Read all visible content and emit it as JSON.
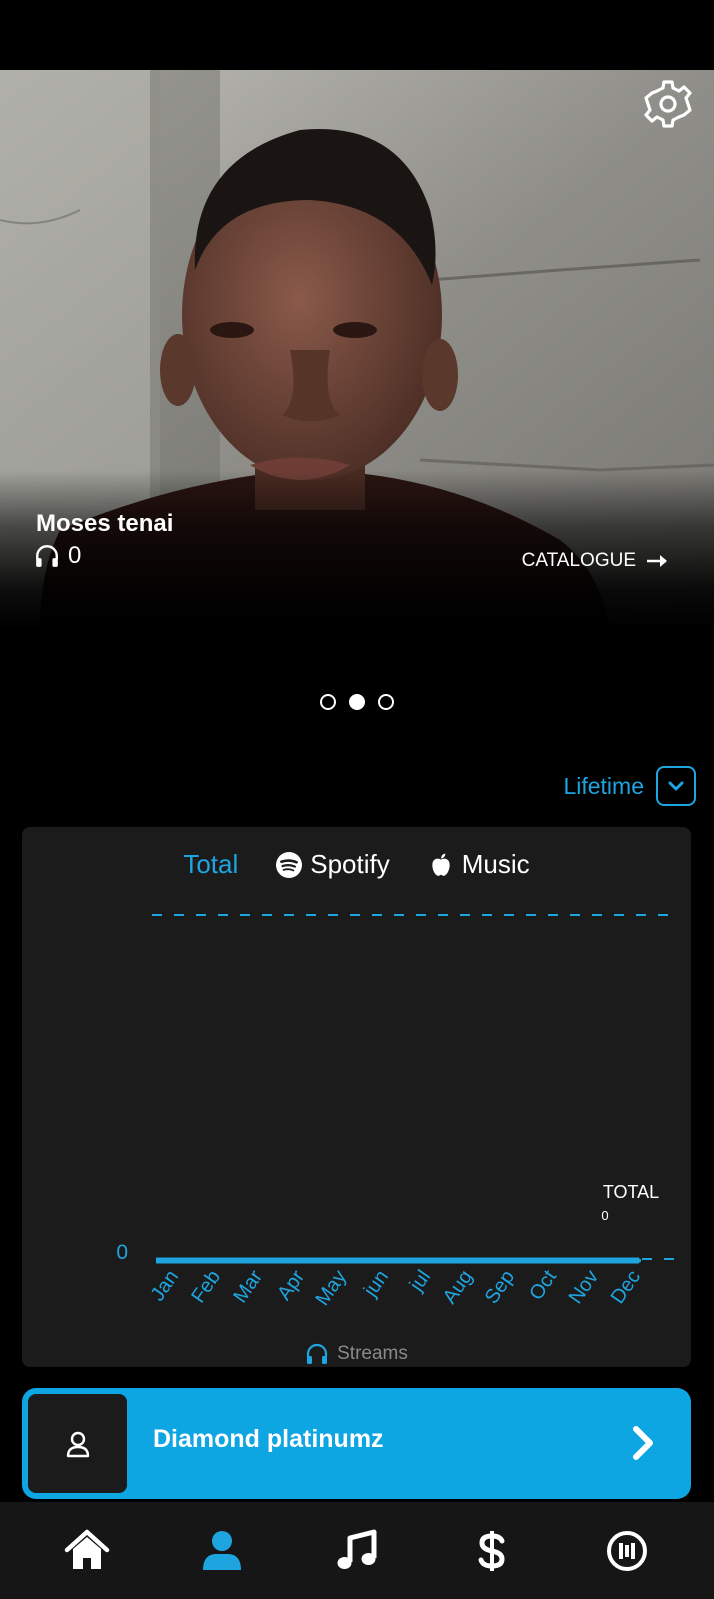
{
  "hero": {
    "artist_name": "Moses tenai",
    "listen_count": "0",
    "catalogue_label": "CATALOGUE",
    "settings_icon": "gear-icon",
    "listen_icon": "headphones-icon",
    "catalogue_icon": "arrow-right-icon"
  },
  "carousel": {
    "count": 3,
    "active_index": 1
  },
  "period": {
    "label": "Lifetime",
    "icon": "chevron-down-icon"
  },
  "tabs": [
    {
      "label": "Total",
      "icon": "",
      "active": true
    },
    {
      "label": "Spotify",
      "icon": "spotify-icon",
      "active": false
    },
    {
      "label": "Music",
      "icon": "apple-icon",
      "active": false
    }
  ],
  "chart_data": {
    "type": "line",
    "categories": [
      "Jan",
      "Feb",
      "Mar",
      "Apr",
      "May",
      "jun",
      "jul",
      "Aug",
      "Sep",
      "Oct",
      "Nov",
      "Dec"
    ],
    "series": [
      {
        "values": [
          0,
          0,
          0,
          0,
          0,
          0,
          0,
          0,
          0,
          0,
          0,
          0
        ]
      }
    ],
    "y_ticks": [
      "0"
    ],
    "total_label": "TOTAL",
    "total_value": "0",
    "xlabel": "Streams",
    "grid": false,
    "colors": {
      "line": "#1ea5e0",
      "axis_text": "#1ea5e0",
      "background": "#1b1b1b"
    }
  },
  "artist_card": {
    "name": "Diamond platinumz",
    "avatar_icon": "user-icon",
    "arrow_icon": "chevron-right-icon"
  },
  "bottom_nav": [
    {
      "icon": "home-icon",
      "active": false
    },
    {
      "icon": "user-icon",
      "active": true
    },
    {
      "icon": "music-note-icon",
      "active": false
    },
    {
      "icon": "dollar-icon",
      "active": false
    },
    {
      "icon": "pause-circle-icon",
      "active": false
    }
  ],
  "colors": {
    "accent": "#1ea5e0",
    "card_accent": "#0ea5e3",
    "background": "#000000",
    "card_bg": "#1b1b1b",
    "nav_bg": "#161616"
  }
}
